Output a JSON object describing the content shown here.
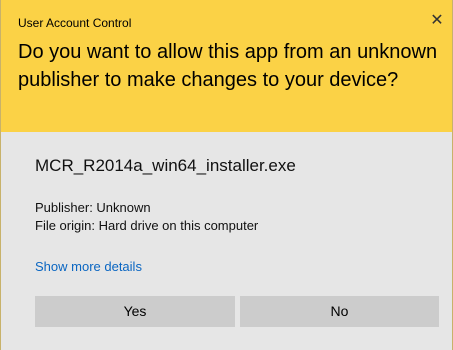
{
  "dialog": {
    "title": "User Account Control",
    "close_glyph": "✕",
    "question": "Do you want to allow this app from an unknown publisher to make changes to your device?",
    "file_name": "MCR_R2014a_win64_installer.exe",
    "publisher": "Publisher: Unknown",
    "file_origin": "File origin: Hard drive on this computer",
    "details_link": "Show more details",
    "yes_label": "Yes",
    "no_label": "No"
  },
  "colors": {
    "header_bg": "#fbd246",
    "body_bg": "#e6e6e6",
    "button_bg": "#cccccc",
    "link": "#0a66c2"
  }
}
